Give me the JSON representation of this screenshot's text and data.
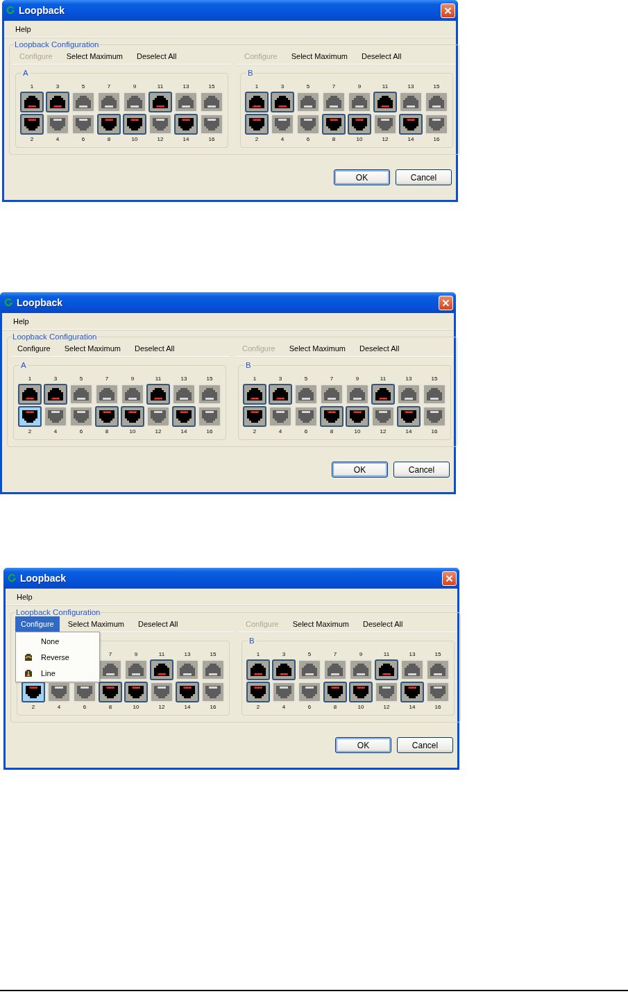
{
  "shots": [
    {
      "title": "Loopback",
      "menu": [
        "Help"
      ],
      "group_title": "Loopback Configuration",
      "panels": [
        {
          "label": "A",
          "toolbar": [
            {
              "label": "Configure",
              "disabled": true,
              "selected": false
            },
            {
              "label": "Select Maximum",
              "disabled": false,
              "selected": false
            },
            {
              "label": "Deselect All",
              "disabled": false,
              "selected": false
            }
          ],
          "top_row": [
            {
              "number": "1",
              "active": true,
              "selected": false
            },
            {
              "number": "3",
              "active": true,
              "selected": false
            },
            {
              "number": "5",
              "active": false,
              "selected": false
            },
            {
              "number": "7",
              "active": false,
              "selected": false
            },
            {
              "number": "9",
              "active": false,
              "selected": false
            },
            {
              "number": "11",
              "active": true,
              "selected": false
            },
            {
              "number": "13",
              "active": false,
              "selected": false
            },
            {
              "number": "15",
              "active": false,
              "selected": false
            }
          ],
          "bottom_row": [
            {
              "number": "2",
              "active": true,
              "selected": false
            },
            {
              "number": "4",
              "active": false,
              "selected": false
            },
            {
              "number": "6",
              "active": false,
              "selected": false
            },
            {
              "number": "8",
              "active": true,
              "selected": false
            },
            {
              "number": "10",
              "active": true,
              "selected": false
            },
            {
              "number": "12",
              "active": false,
              "selected": false
            },
            {
              "number": "14",
              "active": true,
              "selected": false
            },
            {
              "number": "16",
              "active": false,
              "selected": false
            }
          ]
        },
        {
          "label": "B",
          "toolbar": [
            {
              "label": "Configure",
              "disabled": true,
              "selected": false
            },
            {
              "label": "Select Maximum",
              "disabled": false,
              "selected": false
            },
            {
              "label": "Deselect All",
              "disabled": false,
              "selected": false
            }
          ],
          "top_row": [
            {
              "number": "1",
              "active": true,
              "selected": false
            },
            {
              "number": "3",
              "active": true,
              "selected": false
            },
            {
              "number": "5",
              "active": false,
              "selected": false
            },
            {
              "number": "7",
              "active": false,
              "selected": false
            },
            {
              "number": "9",
              "active": false,
              "selected": false
            },
            {
              "number": "11",
              "active": true,
              "selected": false
            },
            {
              "number": "13",
              "active": false,
              "selected": false
            },
            {
              "number": "15",
              "active": false,
              "selected": false
            }
          ],
          "bottom_row": [
            {
              "number": "2",
              "active": true,
              "selected": false
            },
            {
              "number": "4",
              "active": false,
              "selected": false
            },
            {
              "number": "6",
              "active": false,
              "selected": false
            },
            {
              "number": "8",
              "active": true,
              "selected": false
            },
            {
              "number": "10",
              "active": true,
              "selected": false
            },
            {
              "number": "12",
              "active": false,
              "selected": false
            },
            {
              "number": "14",
              "active": true,
              "selected": false
            },
            {
              "number": "16",
              "active": false,
              "selected": false
            }
          ]
        }
      ],
      "buttons": [
        {
          "label": "OK",
          "default": true
        },
        {
          "label": "Cancel",
          "default": false
        }
      ]
    },
    {
      "title": "Loopback",
      "menu": [
        "Help"
      ],
      "group_title": "Loopback Configuration",
      "panels": [
        {
          "label": "A",
          "toolbar": [
            {
              "label": "Configure",
              "disabled": false,
              "selected": false
            },
            {
              "label": "Select Maximum",
              "disabled": false,
              "selected": false
            },
            {
              "label": "Deselect All",
              "disabled": false,
              "selected": false
            }
          ],
          "top_row": [
            {
              "number": "1",
              "active": true,
              "selected": false
            },
            {
              "number": "3",
              "active": true,
              "selected": false
            },
            {
              "number": "5",
              "active": false,
              "selected": false
            },
            {
              "number": "7",
              "active": false,
              "selected": false
            },
            {
              "number": "9",
              "active": false,
              "selected": false
            },
            {
              "number": "11",
              "active": true,
              "selected": false
            },
            {
              "number": "13",
              "active": false,
              "selected": false
            },
            {
              "number": "15",
              "active": false,
              "selected": false
            }
          ],
          "bottom_row": [
            {
              "number": "2",
              "active": true,
              "selected": true
            },
            {
              "number": "4",
              "active": false,
              "selected": false
            },
            {
              "number": "6",
              "active": false,
              "selected": false
            },
            {
              "number": "8",
              "active": true,
              "selected": false
            },
            {
              "number": "10",
              "active": true,
              "selected": false
            },
            {
              "number": "12",
              "active": false,
              "selected": false
            },
            {
              "number": "14",
              "active": true,
              "selected": false
            },
            {
              "number": "16",
              "active": false,
              "selected": false
            }
          ]
        },
        {
          "label": "B",
          "toolbar": [
            {
              "label": "Configure",
              "disabled": true,
              "selected": false
            },
            {
              "label": "Select Maximum",
              "disabled": false,
              "selected": false
            },
            {
              "label": "Deselect All",
              "disabled": false,
              "selected": false
            }
          ],
          "top_row": [
            {
              "number": "1",
              "active": true,
              "selected": false
            },
            {
              "number": "3",
              "active": true,
              "selected": false
            },
            {
              "number": "5",
              "active": false,
              "selected": false
            },
            {
              "number": "7",
              "active": false,
              "selected": false
            },
            {
              "number": "9",
              "active": false,
              "selected": false
            },
            {
              "number": "11",
              "active": true,
              "selected": false
            },
            {
              "number": "13",
              "active": false,
              "selected": false
            },
            {
              "number": "15",
              "active": false,
              "selected": false
            }
          ],
          "bottom_row": [
            {
              "number": "2",
              "active": true,
              "selected": false
            },
            {
              "number": "4",
              "active": false,
              "selected": false
            },
            {
              "number": "6",
              "active": false,
              "selected": false
            },
            {
              "number": "8",
              "active": true,
              "selected": false
            },
            {
              "number": "10",
              "active": true,
              "selected": false
            },
            {
              "number": "12",
              "active": false,
              "selected": false
            },
            {
              "number": "14",
              "active": true,
              "selected": false
            },
            {
              "number": "16",
              "active": false,
              "selected": false
            }
          ]
        }
      ],
      "buttons": [
        {
          "label": "OK",
          "default": true
        },
        {
          "label": "Cancel",
          "default": false
        }
      ]
    },
    {
      "title": "Loopback",
      "menu": [
        "Help"
      ],
      "group_title": "Loopback Configuration",
      "panels": [
        {
          "toolbar": [
            {
              "label": "Configure",
              "disabled": false,
              "selected": true,
              "dropdown": [
                {
                  "label": "None",
                  "kind": "plain"
                },
                {
                  "label": "Reverse",
                  "kind": "reverse"
                },
                {
                  "label": "Line",
                  "kind": "line"
                }
              ]
            },
            {
              "label": "Select Maximum",
              "disabled": false,
              "selected": false
            },
            {
              "label": "Deselect All",
              "disabled": false,
              "selected": false
            }
          ],
          "top_row": [
            {
              "number": "7",
              "active": false,
              "selected": false
            },
            {
              "number": "9",
              "active": false,
              "selected": false
            },
            {
              "number": "11",
              "active": true,
              "selected": false
            },
            {
              "number": "13",
              "active": false,
              "selected": false
            },
            {
              "number": "15",
              "active": false,
              "selected": false
            }
          ],
          "bottom_row": [
            {
              "number": "2",
              "active": true,
              "selected": true
            },
            {
              "number": "4",
              "active": false,
              "selected": false
            },
            {
              "number": "6",
              "active": false,
              "selected": false
            },
            {
              "number": "8",
              "active": true,
              "selected": false
            },
            {
              "number": "10",
              "active": true,
              "selected": false
            },
            {
              "number": "12",
              "active": false,
              "selected": false
            },
            {
              "number": "14",
              "active": true,
              "selected": false
            },
            {
              "number": "16",
              "active": false,
              "selected": false
            }
          ]
        },
        {
          "label": "B",
          "toolbar": [
            {
              "label": "Configure",
              "disabled": true,
              "selected": false
            },
            {
              "label": "Select Maximum",
              "disabled": false,
              "selected": false
            },
            {
              "label": "Deselect All",
              "disabled": false,
              "selected": false
            }
          ],
          "top_row": [
            {
              "number": "1",
              "active": true,
              "selected": false
            },
            {
              "number": "3",
              "active": true,
              "selected": false
            },
            {
              "number": "5",
              "active": false,
              "selected": false
            },
            {
              "number": "7",
              "active": false,
              "selected": false
            },
            {
              "number": "9",
              "active": false,
              "selected": false
            },
            {
              "number": "11",
              "active": true,
              "selected": false
            },
            {
              "number": "13",
              "active": false,
              "selected": false
            },
            {
              "number": "15",
              "active": false,
              "selected": false
            }
          ],
          "bottom_row": [
            {
              "number": "2",
              "active": true,
              "selected": false
            },
            {
              "number": "4",
              "active": false,
              "selected": false
            },
            {
              "number": "6",
              "active": false,
              "selected": false
            },
            {
              "number": "8",
              "active": true,
              "selected": false
            },
            {
              "number": "10",
              "active": true,
              "selected": false
            },
            {
              "number": "12",
              "active": false,
              "selected": false
            },
            {
              "number": "14",
              "active": true,
              "selected": false
            },
            {
              "number": "16",
              "active": false,
              "selected": false
            }
          ]
        }
      ],
      "buttons": [
        {
          "label": "OK",
          "default": true
        },
        {
          "label": "Cancel",
          "default": false
        }
      ]
    }
  ]
}
